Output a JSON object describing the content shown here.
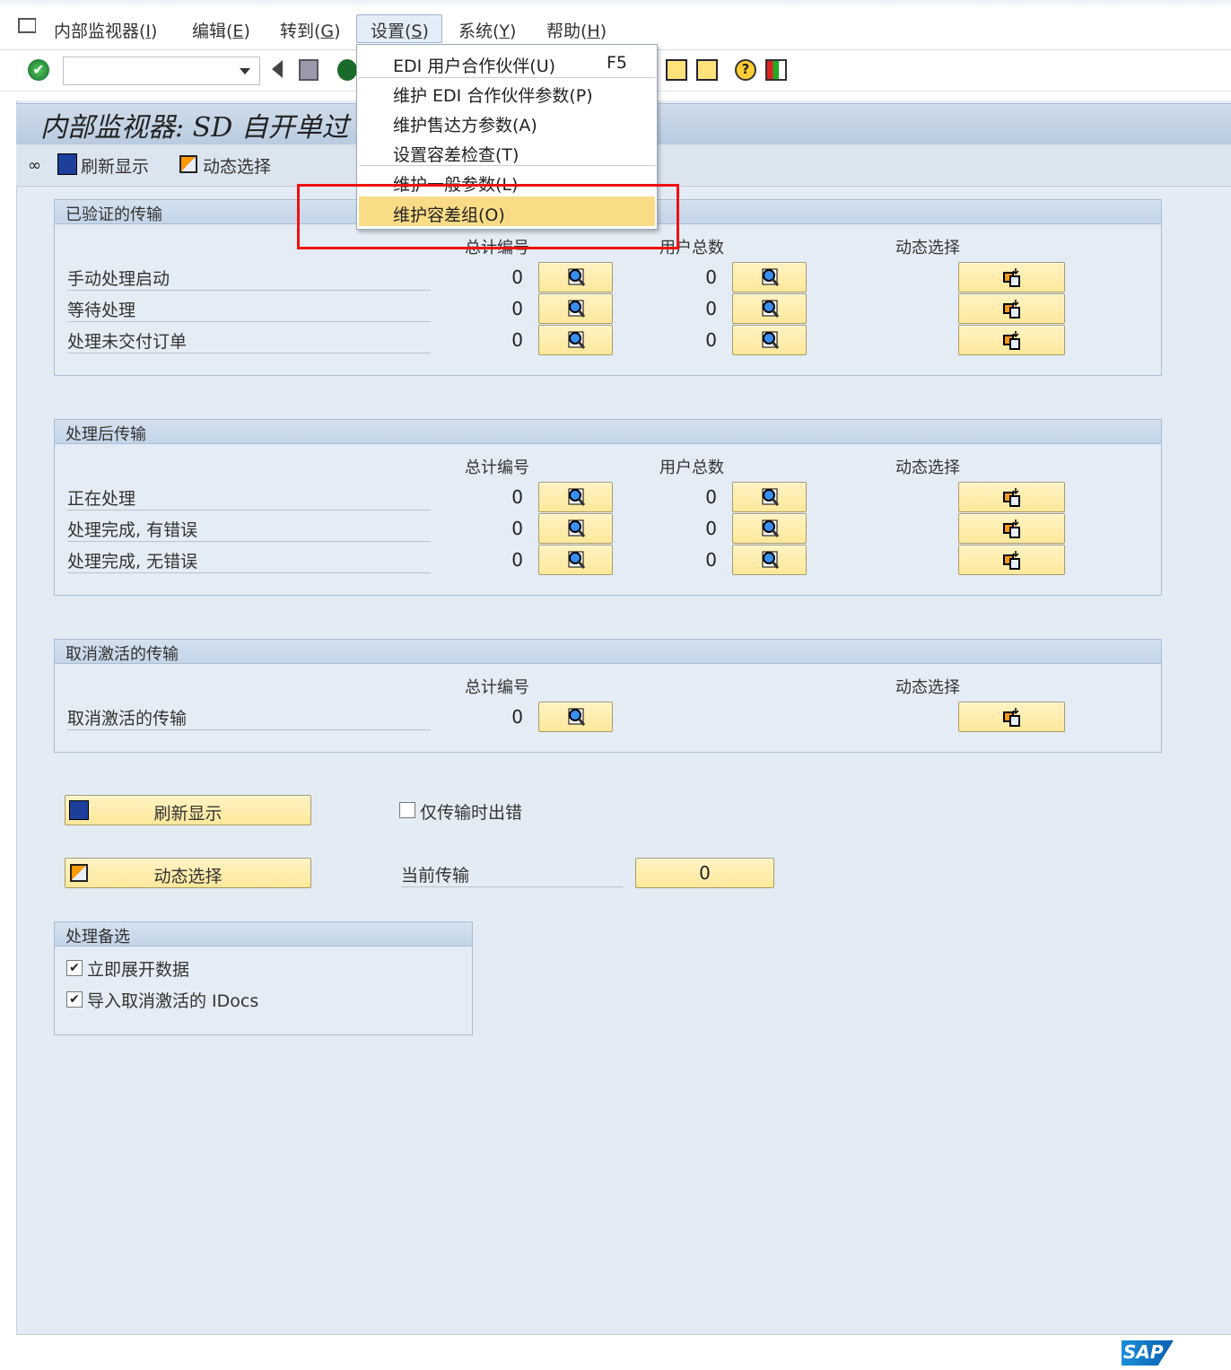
{
  "menubar": {
    "items": [
      {
        "label": "内部监视器(",
        "key": "I",
        "end": ")"
      },
      {
        "label": "编辑(",
        "key": "E",
        "end": ")"
      },
      {
        "label": "转到(",
        "key": "G",
        "end": ")"
      },
      {
        "label": "设置(",
        "key": "S",
        "end": ")"
      },
      {
        "label": "系统(",
        "key": "Y",
        "end": ")"
      },
      {
        "label": "帮助(",
        "key": "H",
        "end": ")"
      }
    ]
  },
  "dropdown": {
    "items": [
      {
        "label": "EDI 用户合作伙伴(U)",
        "shortcut": "F5"
      },
      {
        "label": "维护 EDI 合作伙伴参数(P)"
      },
      {
        "label": "维护售达方参数(A)"
      },
      {
        "label": "设置容差检查(T)"
      },
      {
        "label": "维护一般参数(L)"
      },
      {
        "label": "维护容差组(O)",
        "selected": true
      }
    ]
  },
  "toolbar": {
    "command_value": ""
  },
  "title": "内部监视器: SD 自开单过",
  "apptoolbar": {
    "refresh": "刷新显示",
    "dynamic": "动态选择"
  },
  "sections": [
    {
      "title": "已验证的传输",
      "col_total": "总计编号",
      "col_user": "用户总数",
      "col_dyn": "动态选择",
      "rows": [
        {
          "label": "手动处理启动",
          "total": "0",
          "user": "0"
        },
        {
          "label": "等待处理",
          "total": "0",
          "user": "0"
        },
        {
          "label": "处理未交付订单",
          "total": "0",
          "user": "0"
        }
      ]
    },
    {
      "title": "处理后传输",
      "col_total": "总计编号",
      "col_user": "用户总数",
      "col_dyn": "动态选择",
      "rows": [
        {
          "label": "正在处理",
          "total": "0",
          "user": "0"
        },
        {
          "label": "处理完成, 有错误",
          "total": "0",
          "user": "0"
        },
        {
          "label": "处理完成, 无错误",
          "total": "0",
          "user": "0"
        }
      ]
    },
    {
      "title": "取消激活的传输",
      "col_total": "总计编号",
      "col_dyn": "动态选择",
      "rows": [
        {
          "label": "取消激活的传输",
          "total": "0"
        }
      ]
    }
  ],
  "bottom": {
    "refresh_button": "刷新显示",
    "dynamic_button": "动态选择",
    "only_errors_label": "仅传输时出错",
    "only_errors_checked": false,
    "current_label": "当前传输",
    "current_value": "0"
  },
  "options": {
    "title": "处理备选",
    "items": [
      {
        "label": "立即展开数据",
        "checked": true
      },
      {
        "label": "导入取消激活的 IDocs",
        "checked": true
      }
    ]
  },
  "logo": "SAP"
}
